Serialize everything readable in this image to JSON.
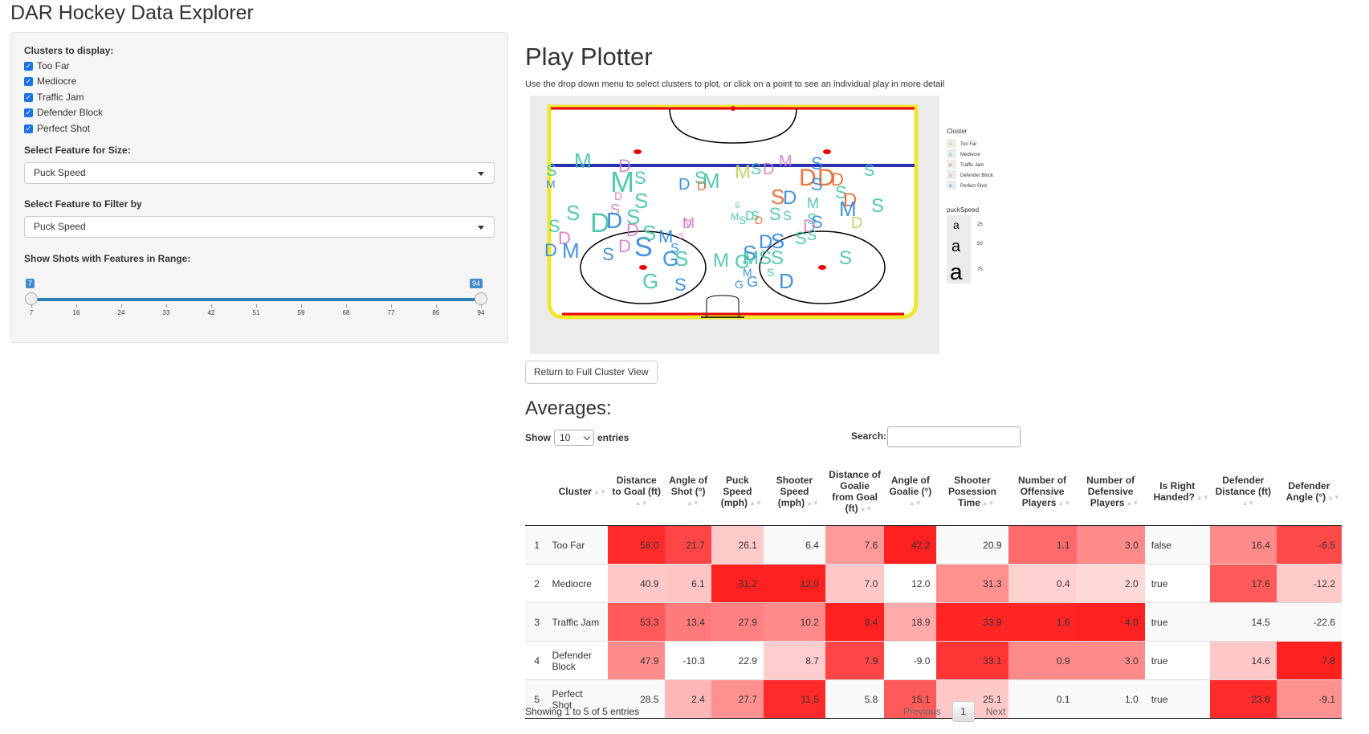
{
  "app": {
    "title": "DAR Hockey Data Explorer"
  },
  "sidebar": {
    "clusters_label": "Clusters to display:",
    "clusters": [
      {
        "label": "Too Far",
        "checked": true
      },
      {
        "label": "Mediocre",
        "checked": true
      },
      {
        "label": "Traffic Jam",
        "checked": true
      },
      {
        "label": "Defender Block",
        "checked": true
      },
      {
        "label": "Perfect Shot",
        "checked": true
      }
    ],
    "size_label": "Select Feature for Size:",
    "size_value": "Puck Speed",
    "filter_label": "Select Feature to Filter by",
    "filter_value": "Puck Speed",
    "range_label": "Show Shots with Features in Range:",
    "range_min": "7",
    "range_max": "94",
    "ticks": [
      "7",
      "16",
      "24",
      "33",
      "42",
      "51",
      "59",
      "68",
      "77",
      "85",
      "94"
    ]
  },
  "main": {
    "title": "Play Plotter",
    "description": "Use the drop down menu to select clusters to plot, or click on a point to see an individual play in more detail",
    "return_button": "Return to Full Cluster View",
    "legend": {
      "cluster_title": "Cluster",
      "clusters": [
        {
          "label": "Too Far",
          "color": "#b6d35a"
        },
        {
          "label": "Mediocre",
          "color": "#40c4a6"
        },
        {
          "label": "Traffic Jam",
          "color": "#e8652a"
        },
        {
          "label": "Defender Block",
          "color": "#d77ac9"
        },
        {
          "label": "Perfect Shot",
          "color": "#2e86de"
        }
      ],
      "size_title": "puckSpeed",
      "size_glyph": "a",
      "size_values": [
        "25",
        "50",
        "75"
      ]
    }
  },
  "averages": {
    "title": "Averages:",
    "show_label": "Show",
    "entries_value": "10",
    "entries_label": "entries",
    "search_label": "Search:",
    "columns": [
      "",
      "Cluster",
      "Distance to Goal (ft)",
      "Angle of Shot (°)",
      "Puck Speed (mph)",
      "Shooter Speed (mph)",
      "Distance of Goalie from Goal (ft)",
      "Angle of Goalie (°)",
      "Shooter Posession Time",
      "Number of Offensive Players",
      "Number of Defensive Players",
      "Is Right Handed?",
      "Defender Distance (ft)",
      "Defender Angle (°)"
    ],
    "rows": [
      [
        "1",
        "Too Far",
        "58.0",
        "21.7",
        "26.1",
        "6.4",
        "7.6",
        "42.2",
        "20.9",
        "1.1",
        "3.0",
        "false",
        "16.4",
        "-6.5"
      ],
      [
        "2",
        "Mediocre",
        "40.9",
        "6.1",
        "31.2",
        "12.0",
        "7.0",
        "12.0",
        "31.3",
        "0.4",
        "2.0",
        "true",
        "17.6",
        "-12.2"
      ],
      [
        "3",
        "Traffic Jam",
        "53.3",
        "13.4",
        "27.9",
        "10.2",
        "8.4",
        "18.9",
        "33.9",
        "1.6",
        "4.0",
        "true",
        "14.5",
        "-22.6"
      ],
      [
        "4",
        "Defender Block",
        "47.9",
        "-10.3",
        "22.9",
        "8.7",
        "7.9",
        "-9.0",
        "33.1",
        "0.9",
        "3.0",
        "true",
        "14.6",
        "7.8"
      ],
      [
        "5",
        "Perfect Shot",
        "28.5",
        "2.4",
        "27.7",
        "11.5",
        "5.8",
        "15.1",
        "25.1",
        "0.1",
        "1.0",
        "true",
        "23.8",
        "-9.1"
      ]
    ],
    "cell_colors": [
      [
        "#ff2a2a",
        "#ff4545",
        "#ffcaca",
        "#ffffff",
        "#ff9a9a",
        "#ff2020",
        "#ffffff",
        "#ff6a6a",
        "#ff8a8a",
        "#ffffff",
        "#ff8a8a",
        "#ff4a4a"
      ],
      [
        "#ffc8c8",
        "#ffc5c5",
        "#ff2020",
        "#ff2020",
        "#ffc8c8",
        "#ffffff",
        "#ff9090",
        "#ffd0d0",
        "#ffd8d8",
        "#ffffff",
        "#ff5a5a",
        "#ffcaca"
      ],
      [
        "#ff5a5a",
        "#ff7a7a",
        "#ff8080",
        "#ff8a8a",
        "#ff2020",
        "#ffaaaa",
        "#ff2525",
        "#ff2525",
        "#ff2020",
        "#ffffff",
        "#ffffff",
        "#ffffff"
      ],
      [
        "#ff8c8c",
        "#ffffff",
        "#ffffff",
        "#ffcdcd",
        "#ff4545",
        "#ffffff",
        "#ff3535",
        "#ff8a8a",
        "#ff8a8a",
        "#ffffff",
        "#ffc8c8",
        "#ff2020"
      ],
      [
        "#ffffff",
        "#ffb6b6",
        "#ff9090",
        "#ff2a2a",
        "#ffffff",
        "#ff5a5a",
        "#ffc8c8",
        "#ffffff",
        "#ffffff",
        "#ffffff",
        "#ff2a2a",
        "#ff9090"
      ]
    ],
    "info": "Showing 1 to 5 of 5 entries",
    "previous": "Previous",
    "page": "1",
    "next": "Next"
  }
}
